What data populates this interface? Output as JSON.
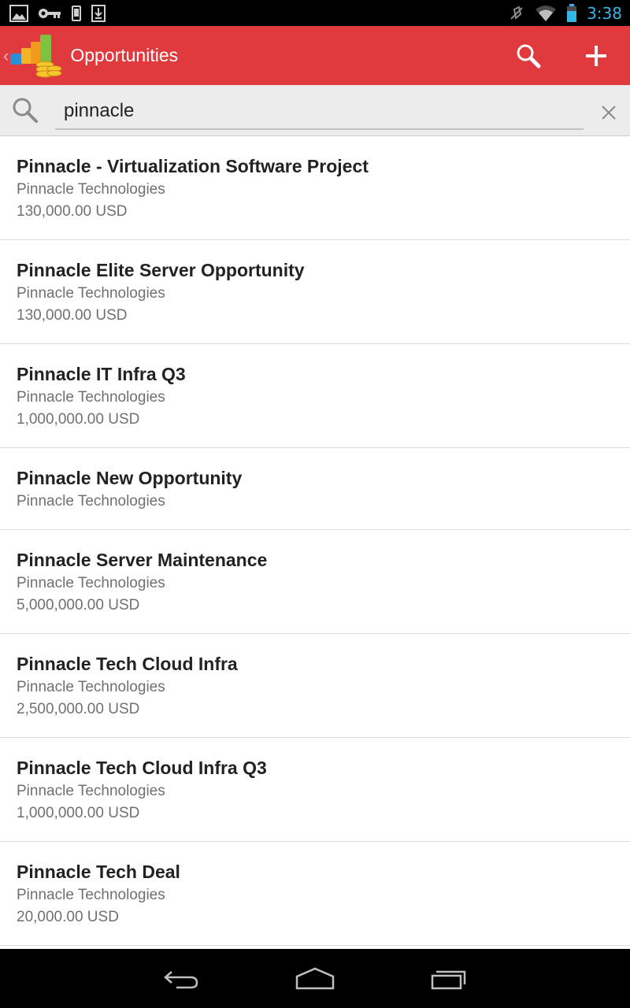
{
  "status_bar": {
    "time": "3:38",
    "left_icons": [
      "image-icon",
      "vpn-key-icon",
      "phone-icon",
      "download-icon"
    ],
    "right_icons": [
      "mute-icon",
      "wifi-icon",
      "battery-icon"
    ]
  },
  "action_bar": {
    "title": "Opportunities",
    "color": "#e0393e",
    "actions": [
      "search-icon",
      "add-icon"
    ]
  },
  "search": {
    "query": "pinnacle"
  },
  "opportunities": [
    {
      "name": "Pinnacle - Virtualization Software Project",
      "account": "Pinnacle Technologies",
      "amount": "130,000.00 USD"
    },
    {
      "name": "Pinnacle Elite Server Opportunity",
      "account": "Pinnacle Technologies",
      "amount": "130,000.00 USD"
    },
    {
      "name": "Pinnacle IT Infra Q3",
      "account": "Pinnacle Technologies",
      "amount": "1,000,000.00 USD"
    },
    {
      "name": "Pinnacle New Opportunity",
      "account": "Pinnacle Technologies",
      "amount": ""
    },
    {
      "name": "Pinnacle Server Maintenance",
      "account": "Pinnacle Technologies",
      "amount": "5,000,000.00 USD"
    },
    {
      "name": "Pinnacle Tech Cloud Infra",
      "account": "Pinnacle Technologies",
      "amount": "2,500,000.00 USD"
    },
    {
      "name": "Pinnacle Tech Cloud Infra Q3",
      "account": "Pinnacle Technologies",
      "amount": "1,000,000.00 USD"
    },
    {
      "name": "Pinnacle Tech Deal",
      "account": "Pinnacle Technologies",
      "amount": "20,000.00 USD"
    }
  ],
  "nav_bar": {
    "buttons": [
      "back-icon",
      "home-icon",
      "recent-apps-icon"
    ]
  }
}
